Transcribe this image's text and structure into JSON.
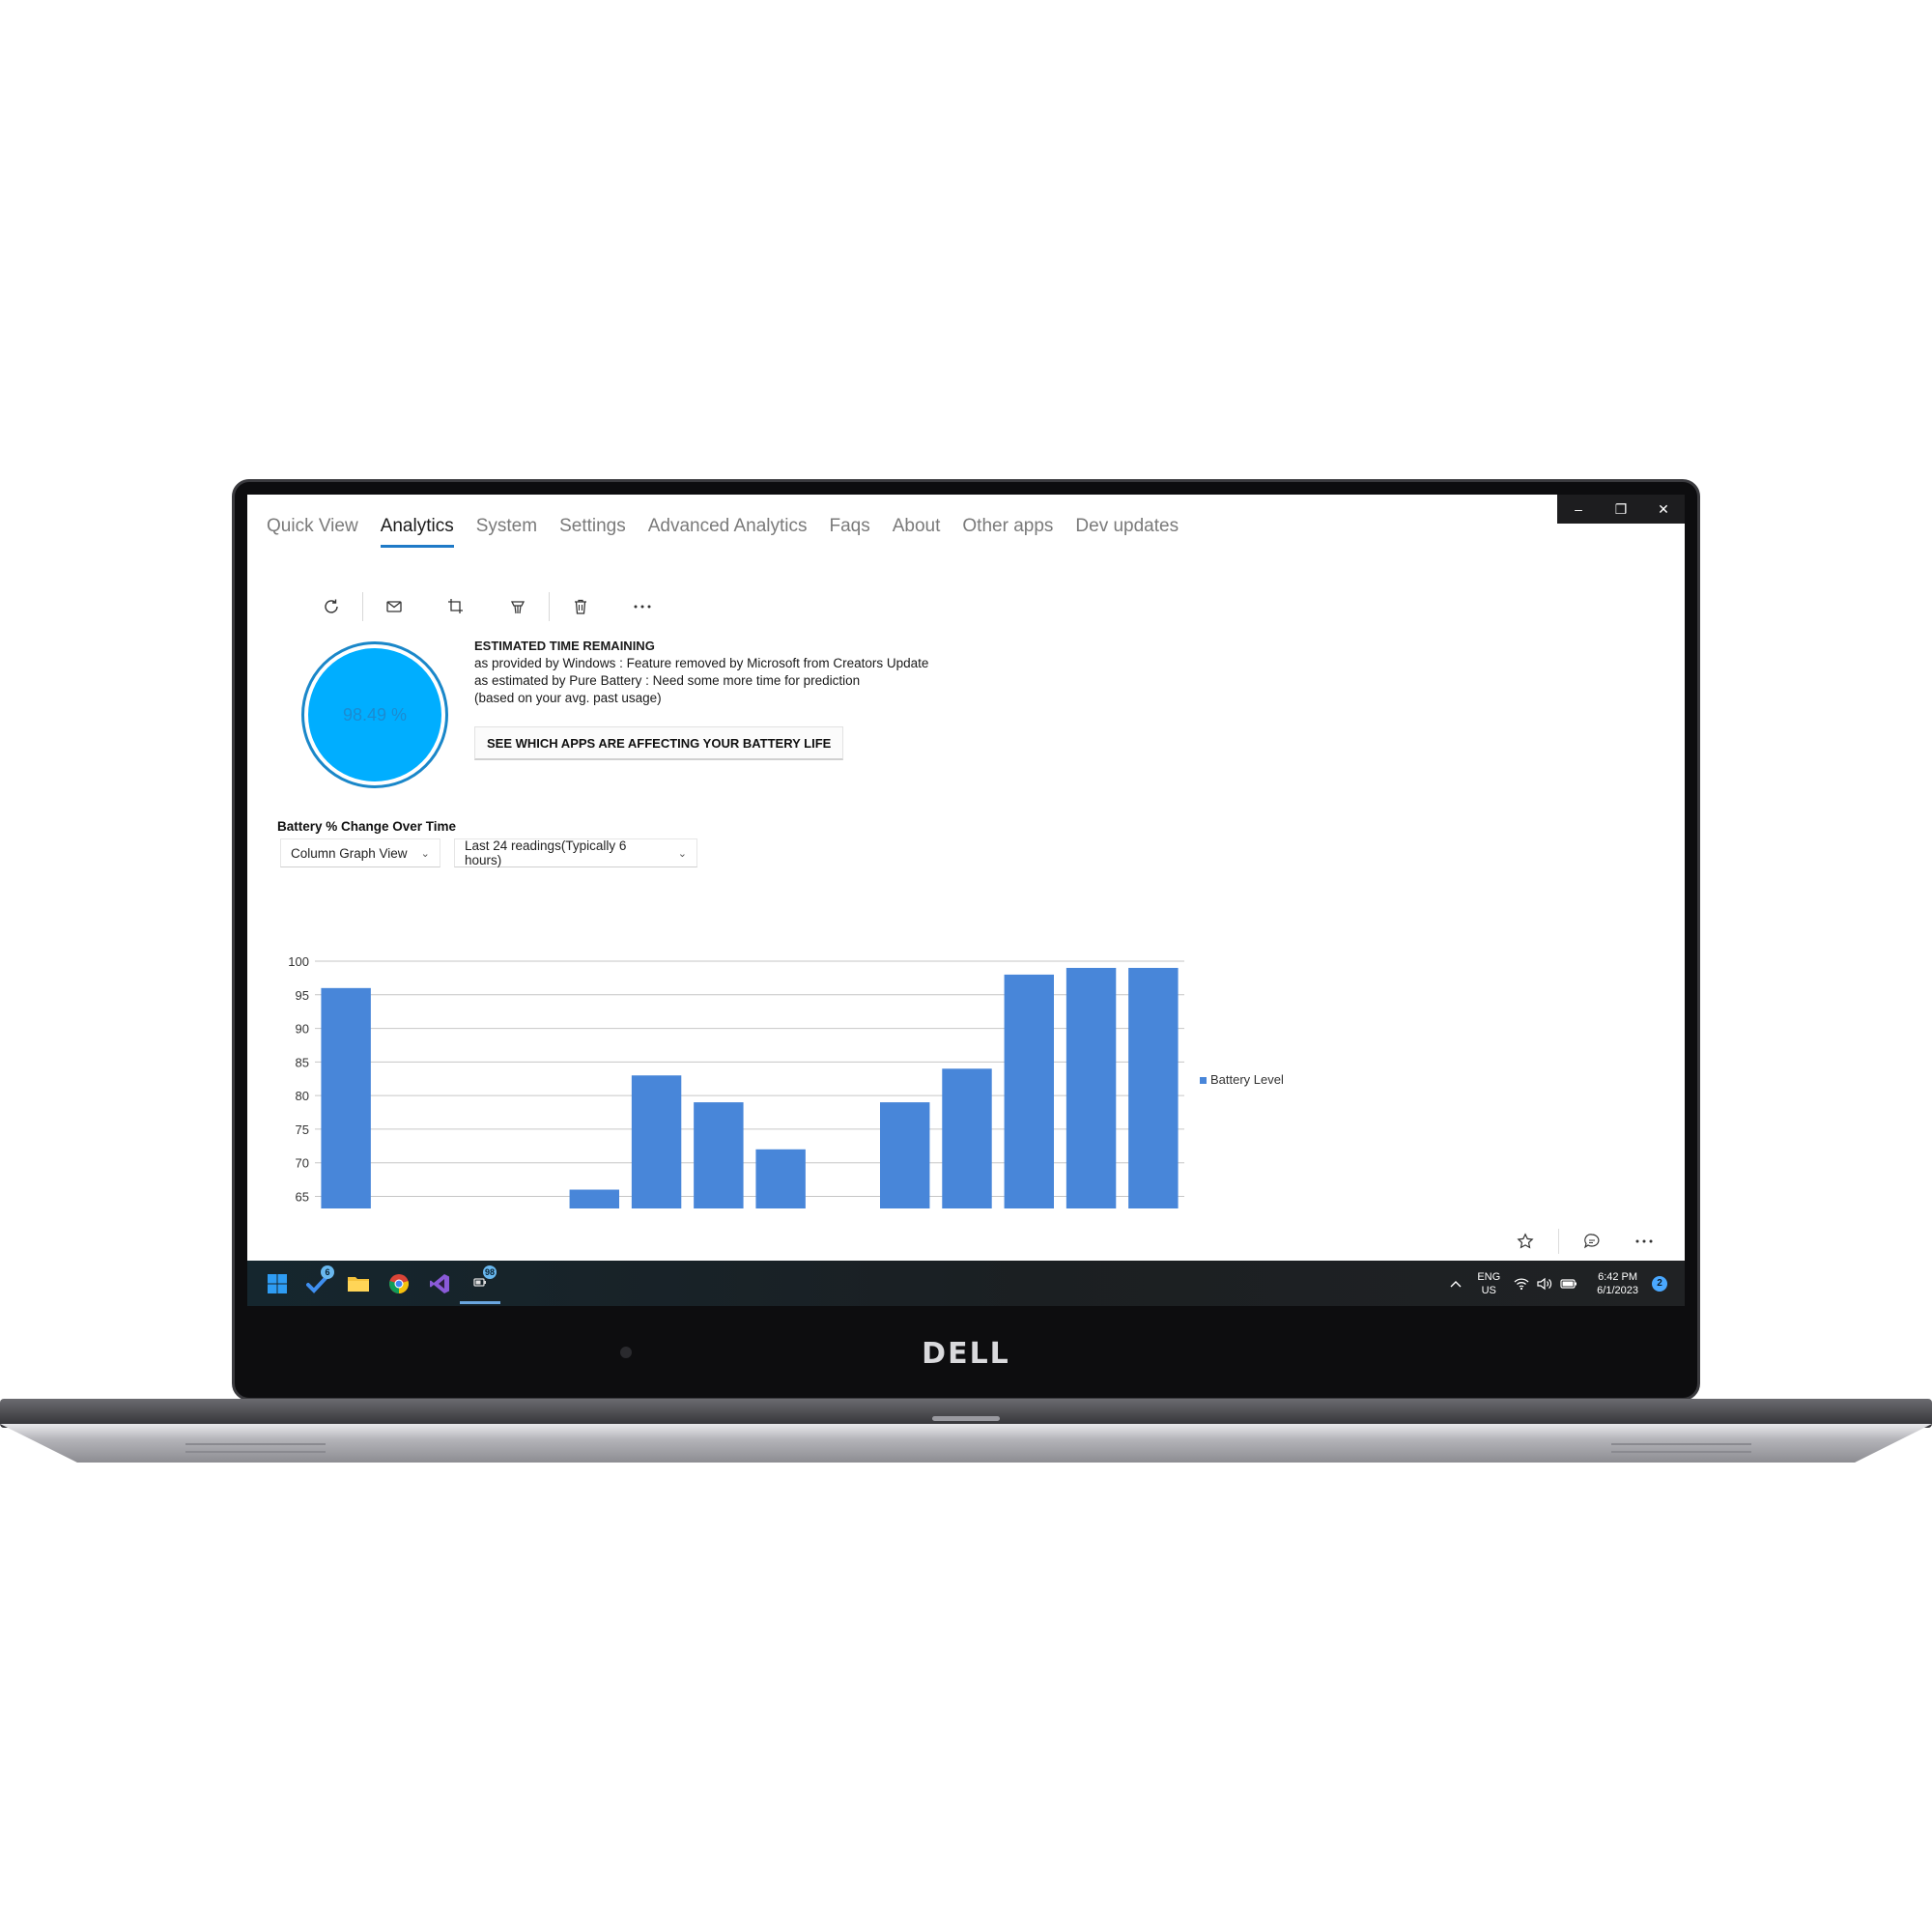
{
  "window": {
    "controls": [
      "–",
      "❐",
      "✕"
    ]
  },
  "nav": {
    "tabs": [
      "Quick View",
      "Analytics",
      "System",
      "Settings",
      "Advanced Analytics",
      "Faqs",
      "About",
      "Other apps",
      "Dev updates"
    ],
    "active_index": 1
  },
  "toolbar": {
    "icons": [
      "refresh-icon",
      "mail-icon",
      "crop-icon",
      "broom-icon",
      "delete-icon",
      "more-icon"
    ]
  },
  "battery": {
    "percent_label": "98.49 %",
    "percent": 98.49
  },
  "estimate": {
    "heading": "ESTIMATED TIME REMAINING",
    "line1": "as provided by Windows :  Feature removed by Microsoft from Creators Update",
    "line2": "as estimated by Pure Battery : Need some more time for prediction",
    "line3": "(based on your avg. past usage)",
    "affect_button": "SEE WHICH APPS ARE AFFECTING YOUR BATTERY LIFE"
  },
  "chart_section": {
    "title": "Battery % Change Over Time",
    "view_select": "Column Graph View",
    "range_select": "Last 24 readings(Typically 6 hours)"
  },
  "chart_data": {
    "type": "bar",
    "values": [
      96,
      null,
      null,
      null,
      66,
      83,
      79,
      72,
      null,
      79,
      84,
      98,
      99,
      99
    ],
    "ylim": [
      63.2,
      100
    ],
    "yticks": [
      65,
      70,
      75,
      80,
      85,
      90,
      95,
      100
    ],
    "series": [
      {
        "name": "Battery Level",
        "color": "#4886d9"
      }
    ],
    "legend_position": "right",
    "grid": true
  },
  "bottom_icons": [
    "star-icon",
    "comment-icon",
    "more-icon"
  ],
  "taskbar": {
    "apps": [
      {
        "icon": "windows-start-icon"
      },
      {
        "icon": "todo-icon",
        "badge": "6"
      },
      {
        "icon": "folder-icon"
      },
      {
        "icon": "chrome-icon"
      },
      {
        "icon": "visual-studio-icon"
      },
      {
        "icon": "pure-battery-icon",
        "badge": "98"
      }
    ],
    "lang_top": "ENG",
    "lang_bottom": "US",
    "time": "6:42 PM",
    "date": "6/1/2023",
    "notifications": "2"
  },
  "brand": "DELL"
}
